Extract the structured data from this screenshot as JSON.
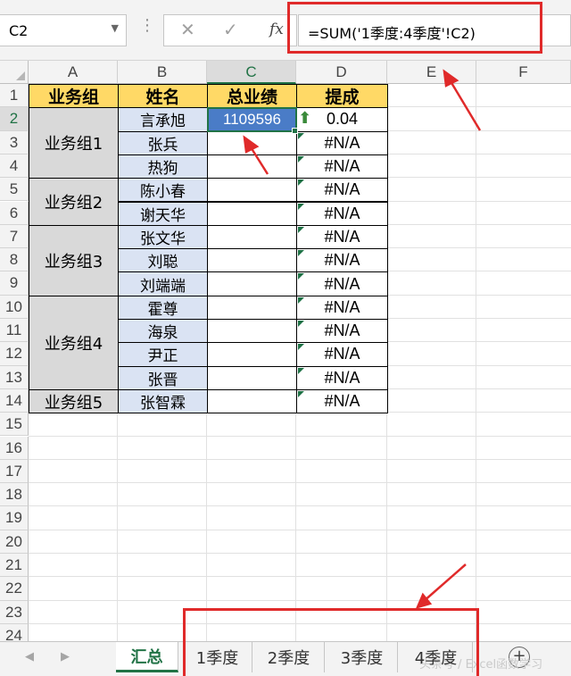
{
  "name_box": {
    "value": "C2"
  },
  "formula_bar": {
    "cancel_icon": "✕",
    "enter_icon": "✓",
    "fx_label": "fx",
    "formula": "=SUM('1季度:4季度'!C2)"
  },
  "columns": [
    "A",
    "B",
    "C",
    "D",
    "E",
    "F"
  ],
  "rows": [
    "1",
    "2",
    "3",
    "4",
    "5",
    "6",
    "7",
    "8",
    "9",
    "10",
    "11",
    "12",
    "13",
    "14",
    "15",
    "16",
    "17",
    "18",
    "19",
    "20",
    "21",
    "22",
    "23",
    "24"
  ],
  "table": {
    "headers": [
      "业务组",
      "姓名",
      "总业绩",
      "提成"
    ],
    "groups": [
      {
        "label": "业务组1",
        "members": [
          "言承旭",
          "张兵",
          "热狗"
        ]
      },
      {
        "label": "业务组2",
        "members": [
          "陈小春",
          "谢天华"
        ]
      },
      {
        "label": "业务组3",
        "members": [
          "张文华",
          "刘聪",
          "刘端端"
        ]
      },
      {
        "label": "业务组4",
        "members": [
          "霍尊",
          "海泉",
          "尹正",
          "张晋"
        ]
      },
      {
        "label": "业务组5",
        "members": [
          "张智霖"
        ]
      }
    ],
    "total_c2": "1109596",
    "commission": [
      "0.04",
      "#N/A",
      "#N/A",
      "#N/A",
      "#N/A",
      "#N/A",
      "#N/A",
      "#N/A",
      "#N/A",
      "#N/A",
      "#N/A",
      "#N/A",
      "#N/A"
    ]
  },
  "sheet_tabs": [
    "汇总",
    "1季度",
    "2季度",
    "3季度",
    "4季度"
  ],
  "active_tab": "汇总",
  "watermark": "头条号 / Excel函数学习",
  "colors": {
    "header_fill": "#ffd966",
    "group_fill": "#d9d9d9",
    "name_fill": "#dae3f3",
    "accent": "#217346",
    "annotation": "#e02a2a"
  }
}
